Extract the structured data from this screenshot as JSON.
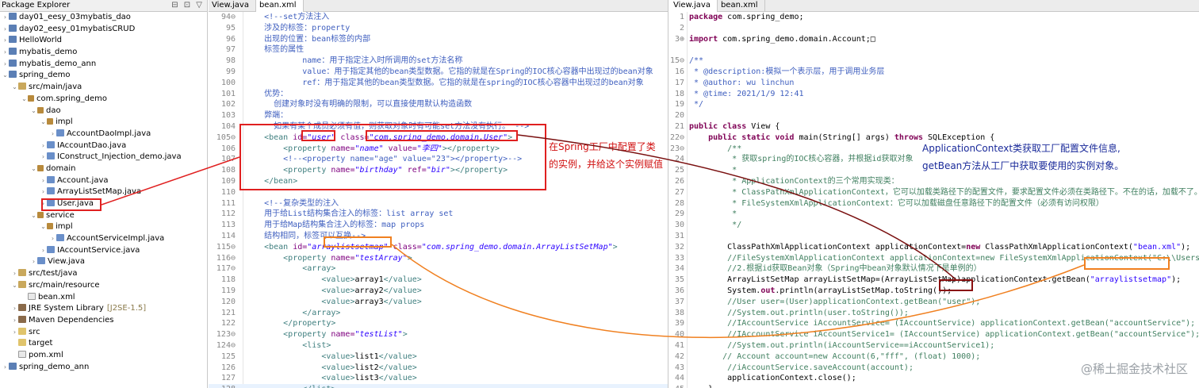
{
  "explorer": {
    "title": "Package Explorer",
    "tools": "⊟ ⊡ ▽",
    "items": [
      {
        "label": "day01_eesy_03mybatis_dao",
        "indent": 0,
        "tw": "›",
        "icon": "proj"
      },
      {
        "label": "day02_eesy_01mybatisCRUD",
        "indent": 0,
        "tw": "›",
        "icon": "proj"
      },
      {
        "label": "HelloWorld",
        "indent": 0,
        "tw": "›",
        "icon": "proj"
      },
      {
        "label": "mybatis_demo",
        "indent": 0,
        "tw": "›",
        "icon": "proj"
      },
      {
        "label": "mybatis_demo_ann",
        "indent": 0,
        "tw": "›",
        "icon": "proj"
      },
      {
        "label": "spring_demo",
        "indent": 0,
        "tw": "⌄",
        "icon": "proj"
      },
      {
        "label": "src/main/java",
        "indent": 1,
        "tw": "⌄",
        "icon": "srcf"
      },
      {
        "label": "com.spring_demo",
        "indent": 2,
        "tw": "⌄",
        "icon": "pkg"
      },
      {
        "label": "dao",
        "indent": 3,
        "tw": "⌄",
        "icon": "pkg"
      },
      {
        "label": "impl",
        "indent": 4,
        "tw": "⌄",
        "icon": "pkg"
      },
      {
        "label": "AccountDaoImpl.java",
        "indent": 5,
        "tw": "›",
        "icon": "java"
      },
      {
        "label": "IAccountDao.java",
        "indent": 4,
        "tw": "›",
        "icon": "java"
      },
      {
        "label": "IConstruct_Injection_demo.java",
        "indent": 4,
        "tw": "›",
        "icon": "java"
      },
      {
        "label": "domain",
        "indent": 3,
        "tw": "⌄",
        "icon": "pkg"
      },
      {
        "label": "Account.java",
        "indent": 4,
        "tw": "›",
        "icon": "java"
      },
      {
        "label": "ArrayListSetMap.java",
        "indent": 4,
        "tw": "›",
        "icon": "java"
      },
      {
        "label": "User.java",
        "indent": 4,
        "tw": "›",
        "icon": "java"
      },
      {
        "label": "service",
        "indent": 3,
        "tw": "⌄",
        "icon": "pkg"
      },
      {
        "label": "impl",
        "indent": 4,
        "tw": "⌄",
        "icon": "pkg"
      },
      {
        "label": "AccountServiceImpl.java",
        "indent": 5,
        "tw": "›",
        "icon": "java"
      },
      {
        "label": "IAccountService.java",
        "indent": 4,
        "tw": "›",
        "icon": "java"
      },
      {
        "label": "View.java",
        "indent": 3,
        "tw": "›",
        "icon": "java"
      },
      {
        "label": "src/test/java",
        "indent": 1,
        "tw": "›",
        "icon": "srcf"
      },
      {
        "label": "src/main/resource",
        "indent": 1,
        "tw": "⌄",
        "icon": "srcf"
      },
      {
        "label": "bean.xml",
        "indent": 2,
        "tw": "",
        "icon": "xml"
      },
      {
        "label": "JRE System Library",
        "suffix": "[J2SE-1.5]",
        "indent": 1,
        "tw": "›",
        "icon": "lib"
      },
      {
        "label": "Maven Dependencies",
        "indent": 1,
        "tw": "›",
        "icon": "lib"
      },
      {
        "label": "src",
        "indent": 1,
        "tw": "›",
        "icon": "fold"
      },
      {
        "label": "target",
        "indent": 1,
        "tw": "",
        "icon": "fold"
      },
      {
        "label": "pom.xml",
        "indent": 1,
        "tw": "",
        "icon": "xml"
      },
      {
        "label": "spring_demo_ann",
        "indent": 0,
        "tw": "›",
        "icon": "proj"
      }
    ]
  },
  "editor_left": {
    "tabs": [
      "View.java",
      "bean.xml"
    ],
    "active_tab": 1,
    "lines": [
      {
        "no": "94⊖",
        "segs": [
          [
            "c-comment",
            "    <!--set方法注入"
          ]
        ]
      },
      {
        "no": "95",
        "segs": [
          [
            "c-comment",
            "    涉及的标签：property"
          ]
        ]
      },
      {
        "no": "96",
        "segs": [
          [
            "c-comment",
            "    出现的位置：bean标签的内部"
          ]
        ]
      },
      {
        "no": "97",
        "segs": [
          [
            "c-comment",
            "    标签的属性"
          ]
        ]
      },
      {
        "no": "98",
        "segs": [
          [
            "c-comment",
            "            name：用于指定注入时所调用的set方法名称"
          ]
        ]
      },
      {
        "no": "99",
        "segs": [
          [
            "c-comment",
            "            value：用于指定其他的bean类型数据。它指的就是在Spring的IOC核心容器中出现过的bean对象"
          ]
        ]
      },
      {
        "no": "100",
        "segs": [
          [
            "c-comment",
            "            ref：用于指定其他的bean类型数据。它指的就是在spring的IOC核心容器中出现过的bean对象"
          ]
        ]
      },
      {
        "no": "101",
        "segs": [
          [
            "c-comment",
            "    优势："
          ]
        ]
      },
      {
        "no": "102",
        "segs": [
          [
            "c-comment",
            "      创建对象时没有明确的限制，可以直接使用默认构造函数"
          ]
        ]
      },
      {
        "no": "103",
        "segs": [
          [
            "c-comment",
            "    弊端："
          ]
        ]
      },
      {
        "no": "104",
        "segs": [
          [
            "c-comment",
            "      如果有某个成员必须有值，则获取对象时有可能set方法没有执行。 -->"
          ]
        ]
      },
      {
        "no": "105⊖",
        "segs": [
          [
            "c-tag",
            "    <bean "
          ],
          [
            "c-attr",
            "id="
          ],
          [
            "c-val",
            "\"user\""
          ],
          [
            "c-attr",
            " class="
          ],
          [
            "c-val",
            "\"com.spring_demo.domain.User\""
          ],
          [
            "c-tag",
            ">"
          ]
        ]
      },
      {
        "no": "106",
        "segs": [
          [
            "c-tag",
            "        <property "
          ],
          [
            "c-attr",
            "name="
          ],
          [
            "c-val",
            "\"name\""
          ],
          [
            "c-attr",
            " value="
          ],
          [
            "c-val",
            "\"李四\""
          ],
          [
            "c-tag",
            "></property>"
          ]
        ]
      },
      {
        "no": "107",
        "segs": [
          [
            "c-comment",
            "        <!--<property name=\"age\" value=\"23\"></property>-->"
          ]
        ]
      },
      {
        "no": "108",
        "segs": [
          [
            "c-tag",
            "        <property "
          ],
          [
            "c-attr",
            "name="
          ],
          [
            "c-val",
            "\"birthday\""
          ],
          [
            "c-attr",
            " ref="
          ],
          [
            "c-val",
            "\"bir\""
          ],
          [
            "c-tag",
            "></property>"
          ]
        ]
      },
      {
        "no": "109",
        "segs": [
          [
            "c-tag",
            "    </bean>"
          ]
        ]
      },
      {
        "no": "110",
        "segs": [
          [
            "c-tag",
            ""
          ]
        ]
      },
      {
        "no": "111",
        "segs": [
          [
            "c-comment",
            "    <!--复杂类型的注入"
          ]
        ]
      },
      {
        "no": "112",
        "segs": [
          [
            "c-comment",
            "    用于给List结构集合注入的标签：list array set"
          ]
        ]
      },
      {
        "no": "113",
        "segs": [
          [
            "c-comment",
            "    用于给Map结构集合注入的标签：map props"
          ]
        ]
      },
      {
        "no": "114",
        "segs": [
          [
            "c-comment",
            "    结构相同，标签可以互换-->"
          ]
        ]
      },
      {
        "no": "115⊖",
        "segs": [
          [
            "c-tag",
            "    <bean "
          ],
          [
            "c-attr",
            "id="
          ],
          [
            "c-val",
            "\"arraylistsetmap\""
          ],
          [
            "c-attr",
            " class="
          ],
          [
            "c-val",
            "\"com.spring_demo.domain.ArrayListSetMap\""
          ],
          [
            "c-tag",
            ">"
          ]
        ]
      },
      {
        "no": "116⊖",
        "segs": [
          [
            "c-tag",
            "        <property "
          ],
          [
            "c-attr",
            "name="
          ],
          [
            "c-val",
            "\"testArray\""
          ],
          [
            "c-tag",
            ">"
          ]
        ]
      },
      {
        "no": "117⊖",
        "segs": [
          [
            "c-tag",
            "            <array>"
          ]
        ]
      },
      {
        "no": "118",
        "segs": [
          [
            "c-tag",
            "                <value>"
          ],
          [
            "",
            "array1"
          ],
          [
            "c-tag",
            "</value>"
          ]
        ]
      },
      {
        "no": "119",
        "segs": [
          [
            "c-tag",
            "                <value>"
          ],
          [
            "",
            "array2"
          ],
          [
            "c-tag",
            "</value>"
          ]
        ]
      },
      {
        "no": "120",
        "segs": [
          [
            "c-tag",
            "                <value>"
          ],
          [
            "",
            "array3"
          ],
          [
            "c-tag",
            "</value>"
          ]
        ]
      },
      {
        "no": "121",
        "segs": [
          [
            "c-tag",
            "            </array>"
          ]
        ]
      },
      {
        "no": "122",
        "segs": [
          [
            "c-tag",
            "        </property>"
          ]
        ]
      },
      {
        "no": "123⊖",
        "segs": [
          [
            "c-tag",
            "        <property "
          ],
          [
            "c-attr",
            "name="
          ],
          [
            "c-val",
            "\"testList\""
          ],
          [
            "c-tag",
            ">"
          ]
        ]
      },
      {
        "no": "124⊖",
        "segs": [
          [
            "c-tag",
            "            <list>"
          ]
        ]
      },
      {
        "no": "125",
        "segs": [
          [
            "c-tag",
            "                <value>"
          ],
          [
            "",
            "list1"
          ],
          [
            "c-tag",
            "</value>"
          ]
        ]
      },
      {
        "no": "126",
        "segs": [
          [
            "c-tag",
            "                <value>"
          ],
          [
            "",
            "list2"
          ],
          [
            "c-tag",
            "</value>"
          ]
        ]
      },
      {
        "no": "127",
        "segs": [
          [
            "c-tag",
            "                <value>"
          ],
          [
            "",
            "list3"
          ],
          [
            "c-tag",
            "</value>"
          ]
        ]
      },
      {
        "no": "128",
        "segs": [
          [
            "c-tag",
            "            </list>"
          ]
        ],
        "cur": true
      }
    ]
  },
  "editor_right": {
    "tabs": [
      "View.java",
      "bean.xml"
    ],
    "active_tab": 0,
    "lines": [
      {
        "no": "1",
        "segs": [
          [
            "c-kw",
            "package"
          ],
          [
            "",
            " com.spring_demo;"
          ]
        ]
      },
      {
        "no": "2",
        "segs": [
          [
            "",
            ""
          ]
        ]
      },
      {
        "no": "3⊕",
        "segs": [
          [
            "c-kw",
            "import"
          ],
          [
            "",
            " com.spring_demo.domain.Account;□"
          ]
        ]
      },
      {
        "no": "",
        "segs": [
          [
            "",
            ""
          ]
        ]
      },
      {
        "no": "15⊖",
        "segs": [
          [
            "c-comment",
            "/**"
          ]
        ]
      },
      {
        "no": "16",
        "segs": [
          [
            "c-comment",
            " * @description:模拟一个表示层，用于调用业务层"
          ]
        ]
      },
      {
        "no": "17",
        "segs": [
          [
            "c-comment",
            " * @author: wu linchun"
          ]
        ]
      },
      {
        "no": "18",
        "segs": [
          [
            "c-comment",
            " * @time: 2021/1/9 12:41"
          ]
        ]
      },
      {
        "no": "19",
        "segs": [
          [
            "c-comment",
            " */"
          ]
        ]
      },
      {
        "no": "20",
        "segs": [
          [
            "",
            ""
          ]
        ]
      },
      {
        "no": "21",
        "segs": [
          [
            "c-kw",
            "public class"
          ],
          [
            "",
            " View {"
          ]
        ]
      },
      {
        "no": "22⊖",
        "segs": [
          [
            "c-kw",
            "    public static void"
          ],
          [
            "",
            " main(String[] args) "
          ],
          [
            "c-kw",
            "throws"
          ],
          [
            "",
            " SQLException {"
          ]
        ]
      },
      {
        "no": "23⊖",
        "segs": [
          [
            "c-jcom",
            "        /**"
          ]
        ]
      },
      {
        "no": "24",
        "segs": [
          [
            "c-jcom",
            "         * 获取spring的IOC核心容器，并根据id获取对象"
          ]
        ]
      },
      {
        "no": "25",
        "segs": [
          [
            "c-jcom",
            "         *"
          ]
        ]
      },
      {
        "no": "26",
        "segs": [
          [
            "c-jcom",
            "         * ApplicationContext的三个常用实现类："
          ]
        ]
      },
      {
        "no": "27",
        "segs": [
          [
            "c-jcom",
            "         * ClassPathXmlApplicationContext，它可以加载类路径下的配置文件，要求配置文件必须在类路径下。不在的话，加载不了。"
          ]
        ]
      },
      {
        "no": "28",
        "segs": [
          [
            "c-jcom",
            "         * FileSystemXmlApplicationContext：它可以加载磁盘任意路径下的配置文件（必须有访问权限）"
          ]
        ]
      },
      {
        "no": "29",
        "segs": [
          [
            "c-jcom",
            "         *"
          ]
        ]
      },
      {
        "no": "30",
        "segs": [
          [
            "c-jcom",
            "         */"
          ]
        ]
      },
      {
        "no": "31",
        "segs": [
          [
            "",
            ""
          ]
        ]
      },
      {
        "no": "32",
        "segs": [
          [
            "",
            "        ClassPathXmlApplicationContext applicationContext="
          ],
          [
            "c-kw",
            "new"
          ],
          [
            "",
            " ClassPathXmlApplicationContext("
          ],
          [
            "c-str",
            "\"bean.xml\""
          ],
          [
            "",
            ");"
          ]
        ]
      },
      {
        "no": "33",
        "segs": [
          [
            "c-jcom",
            "        //FileSystemXmlApplicationContext applicationContext=new FileSystemXmlApplicationContext(\"C:\\\\Users\\"
          ]
        ]
      },
      {
        "no": "34",
        "segs": [
          [
            "c-jcom",
            "        //2.根据id获取Bean对象（Spring中bean对象默认情况下是单例的）"
          ]
        ]
      },
      {
        "no": "35",
        "segs": [
          [
            "",
            "        ArrayListSetMap arrayListSetMap=(ArrayListSetMap)applicationContext.getBean("
          ],
          [
            "c-str",
            "\"arraylistsetmap\""
          ],
          [
            "",
            ");"
          ]
        ]
      },
      {
        "no": "36",
        "segs": [
          [
            "",
            "        System."
          ],
          [
            "c-kw",
            "out"
          ],
          [
            "",
            ".println(arrayListSetMap.toString());"
          ]
        ]
      },
      {
        "no": "37",
        "segs": [
          [
            "c-jcom",
            "        //User user=(User)applicationContext.getBean(\"user\");"
          ]
        ]
      },
      {
        "no": "38",
        "segs": [
          [
            "c-jcom",
            "        //System.out.println(user.toString());"
          ]
        ]
      },
      {
        "no": "39",
        "segs": [
          [
            "c-jcom",
            "        //IAccountService iAccountService= (IAccountService) applicationContext.getBean(\"accountService\");"
          ]
        ]
      },
      {
        "no": "40",
        "segs": [
          [
            "c-jcom",
            "        //IAccountService iAccountService1= (IAccountService) applicationContext.getBean(\"accountService\");"
          ]
        ]
      },
      {
        "no": "41",
        "segs": [
          [
            "c-jcom",
            "        //System.out.println(iAccountService==iAccountService1);"
          ]
        ]
      },
      {
        "no": "42",
        "segs": [
          [
            "c-jcom",
            "       // Account account=new Account(6,\"fff\", (float) 1000);"
          ]
        ]
      },
      {
        "no": "43",
        "segs": [
          [
            "c-jcom",
            "        //iAccountService.saveAccount(account);"
          ]
        ]
      },
      {
        "no": "44",
        "segs": [
          [
            "",
            "        applicationContext.close();"
          ]
        ]
      },
      {
        "no": "45",
        "segs": [
          [
            "",
            "    }"
          ]
        ]
      },
      {
        "no": "46",
        "segs": [
          [
            "",
            "}"
          ]
        ]
      }
    ]
  },
  "annotations": {
    "left_note_line1": "在Spring工厂中配置了类",
    "left_note_line2": "的实例，并给这个实例赋值",
    "right_note_line1": "ApplicationContext类获取工厂配置文件信息,",
    "right_note_line2": "getBean方法从工厂中获取要使用的实例对象。"
  },
  "watermark": "@稀土掘金技术社区",
  "colors": {
    "annotation_red": "#e02020",
    "annotation_orange": "#f08020",
    "annotation_dark": "#8a1010"
  }
}
